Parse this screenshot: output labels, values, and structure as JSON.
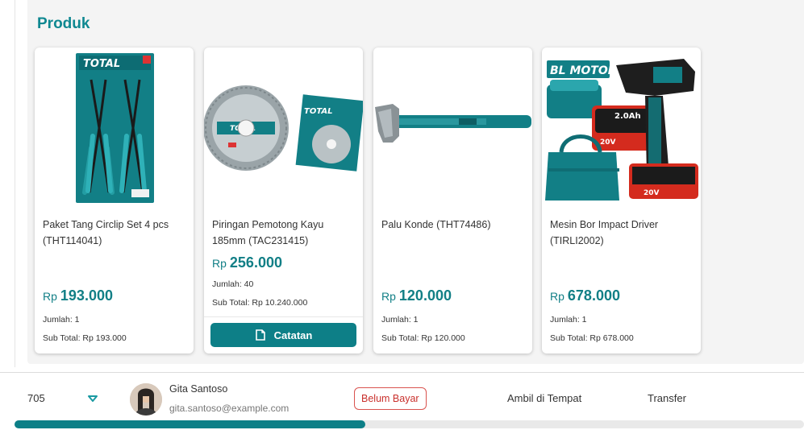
{
  "section": {
    "title": "Produk"
  },
  "products": [
    {
      "name": "Paket Tang Circlip Set 4 pcs (THT114041)",
      "price_currency": "Rp",
      "price_value": "193.000",
      "qty": "Jumlah: 1",
      "subtotal": "Sub Total: Rp 193.000"
    },
    {
      "name": "Piringan Pemotong Kayu 185mm (TAC231415)",
      "price_currency": "Rp",
      "price_value": "256.000",
      "qty": "Jumlah: 40",
      "subtotal": "Sub Total: Rp 10.240.000",
      "note_label": "Catatan"
    },
    {
      "name": "Palu Konde (THT74486)",
      "price_currency": "Rp",
      "price_value": "120.000",
      "qty": "Jumlah: 1",
      "subtotal": "Sub Total: Rp 120.000"
    },
    {
      "name": "Mesin Bor Impact Driver (TIRLI2002)",
      "price_currency": "Rp",
      "price_value": "678.000",
      "qty": "Jumlah: 1",
      "subtotal": "Sub Total: Rp 678.000"
    }
  ],
  "product_image_text": {
    "brand": "TOTAL",
    "bl_motor": "BL MOTOR",
    "battery": "2.0Ah",
    "voltage": "20V"
  },
  "order": {
    "id": "705",
    "customer_name": "Gita Santoso",
    "customer_email": "gita.santoso@example.com",
    "status": "Belum Bayar",
    "delivery": "Ambil di Tempat",
    "payment": "Transfer"
  },
  "colors": {
    "accent": "#0f8891",
    "price": "#127f86",
    "status_border": "#d9534f"
  },
  "scroll": {
    "position_fraction": 0.44
  }
}
